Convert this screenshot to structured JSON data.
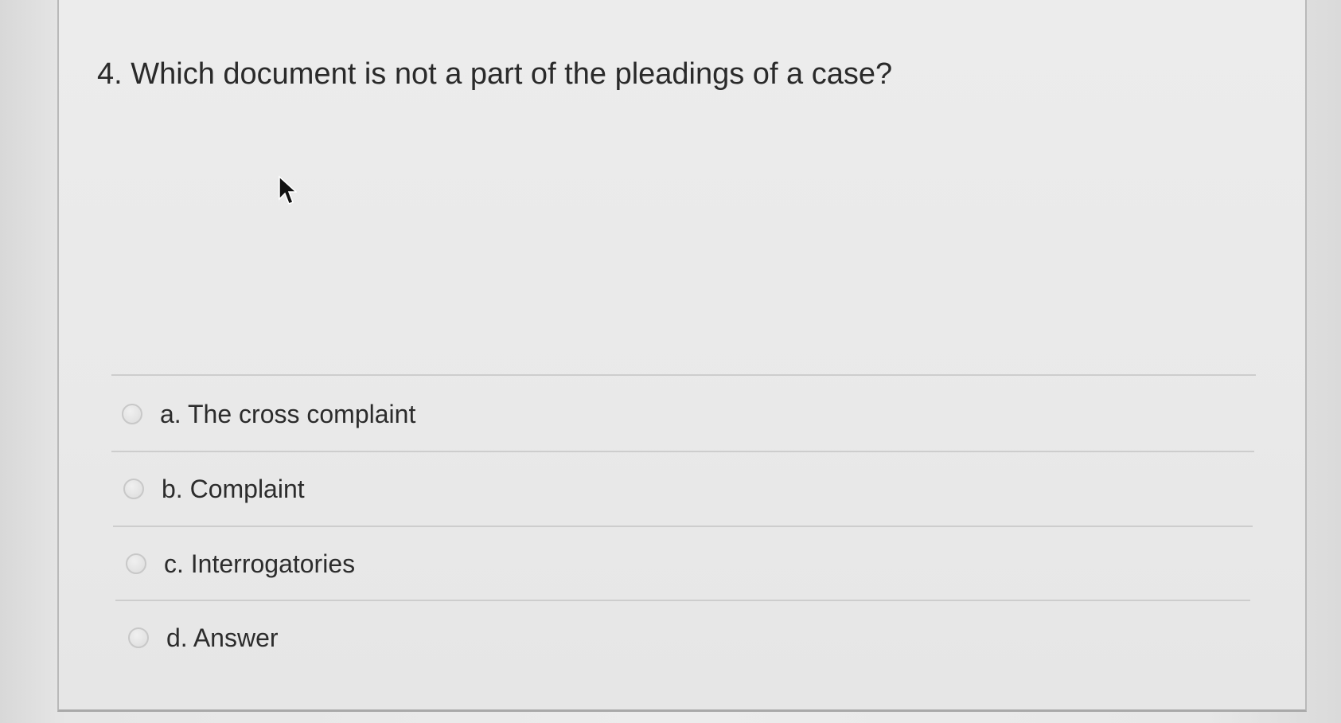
{
  "question": {
    "text": "4. Which document is not a part of the pleadings of a case?"
  },
  "options": [
    {
      "label": "a. The cross complaint",
      "selected": false
    },
    {
      "label": "b. Complaint",
      "selected": false
    },
    {
      "label": "c. Interrogatories",
      "selected": false
    },
    {
      "label": "d. Answer",
      "selected": false
    }
  ],
  "icons": {
    "cursor": "mouse-pointer-icon",
    "radio": "radio-unselected-icon"
  }
}
